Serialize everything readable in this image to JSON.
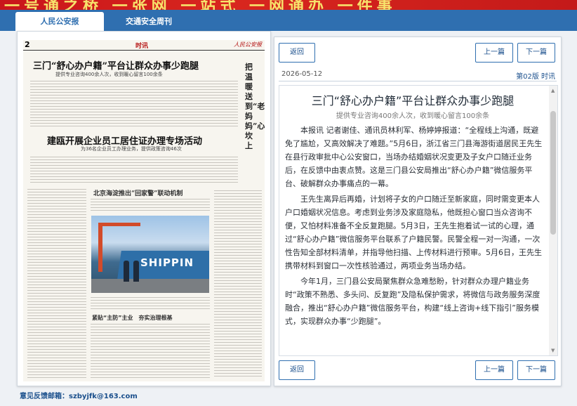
{
  "banner": {
    "text": "一号通之桥 一张网 一站式 一网通办 一件事"
  },
  "tabs": [
    {
      "label": "人民公安报"
    },
    {
      "label": "交通安全周刊"
    }
  ],
  "newspaper": {
    "page_number": "2",
    "section": "时讯",
    "logo": "人民公安报",
    "headline1": "三门“舒心办户籍”平台让群众办事少跑腿",
    "headline1_sub": "提供专业咨询400余人次，收到暖心留言100余条",
    "headline2": "建瓯开展企业员工居住证办理专场活动",
    "headline2_sub": "为36名企业员工办理业务，提供政策咨询46次",
    "headline3": "北京海淀推出“回家警”联动机制",
    "headline4": "紧贴“主防”主业　夯实治理根基",
    "vertical_title": "把温暖送到“老妈妈”心坎上",
    "photo_text": "SHIPPIN"
  },
  "feedback": {
    "label": "意见反馈邮箱：",
    "email": "szbyjfk@163.com"
  },
  "article": {
    "back_label": "返回",
    "prev_label": "上一篇",
    "next_label": "下一篇",
    "date": "2026-05-12",
    "edition": "第02版 时讯",
    "title": "三门“舒心办户籍”平台让群众办事少跑腿",
    "subtitle": "提供专业咨询400余人次，收到暖心留言100余条",
    "paragraphs": [
      "本报讯 记者谢佳、通讯员林利军、杨婷婷报道：“全程线上沟通，既避免了尴尬，又高效解决了难题。”5月6日，浙江省三门县海游街道居民王先生在县行政审批中心公安窗口，当场办结婚姻状况变更及子女户口随迁业务后，在反馈中由衷点赞。这是三门县公安局推出“舒心办户籍”微信服务平台、破解群众办事痛点的一幕。",
      "王先生离异后再婚，计划将子女的户口随迁至新家庭，同时需变更本人户口婚姻状况信息。考虑到业务涉及家庭隐私，他既担心窗口当众咨询不便，又怕材料准备不全反复跑腿。5月3日，王先生抱着试一试的心理，通过“舒心办户籍”微信服务平台联系了户籍民警。民警全程一对一沟通，一次性告知全部材料清单，并指导他扫描、上传材料进行预审。5月6日，王先生携带材料到窗口一次性核验通过，两项业务当场办结。",
      "今年1月，三门县公安局聚焦群众急难愁盼，针对群众办理户籍业务时“政策不熟悉、多头问、反复跑”及隐私保护需求，将微信与政务服务深度融合，推出“舒心办户籍”微信服务平台，构建“线上咨询+线下指引”服务模式，实现群众办事“少跑腿”。"
    ]
  }
}
